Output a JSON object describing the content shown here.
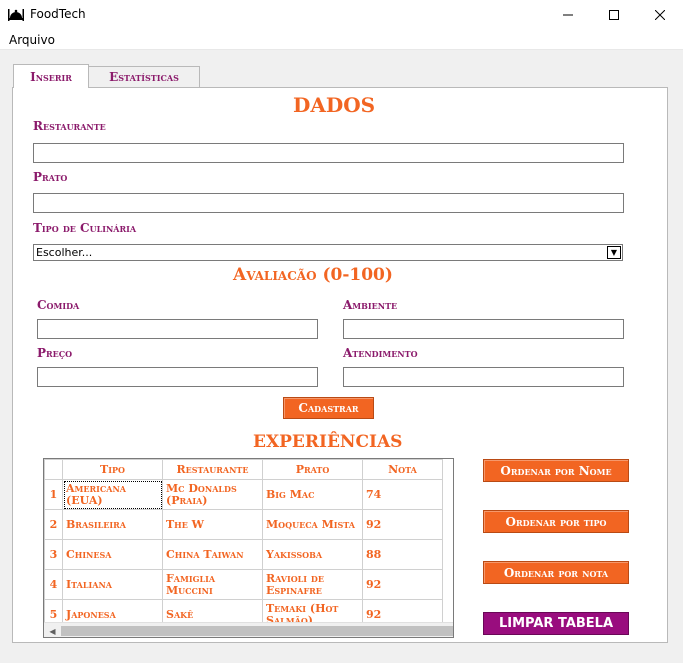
{
  "window": {
    "title": "FoodTech",
    "minimize": "—",
    "maximize": "☐",
    "close": "✕"
  },
  "menu": {
    "file": "Arquivo"
  },
  "tabs": {
    "insert": "Inserir",
    "stats": "Estatísticas"
  },
  "form": {
    "section_title": "DADOS",
    "restaurant_label": "Restaurante",
    "restaurant_value": "",
    "dish_label": "Prato",
    "dish_value": "",
    "cuisine_label": "Tipo de Culinária",
    "cuisine_selected": "Escolher...",
    "rating_title": "Avaliacão (0-100)",
    "food_label": "Comida",
    "food_value": "",
    "ambience_label": "Ambiente",
    "ambience_value": "",
    "price_label": "Preço",
    "price_value": "",
    "service_label": "Atendimento",
    "service_value": "",
    "submit_label": "Cadastrar"
  },
  "experiences": {
    "title": "EXPERIÊNCIAS",
    "columns": [
      "Tipo",
      "Restaurante",
      "Prato",
      "Nota"
    ],
    "rows": [
      {
        "num": "1",
        "tipo": "Americana (EUA)",
        "restaurante": "Mc Donalds (Praia)",
        "prato": "Big Mac",
        "nota": "74"
      },
      {
        "num": "2",
        "tipo": "Brasileira",
        "restaurante": "The W",
        "prato": "Moqueca Mista",
        "nota": "92"
      },
      {
        "num": "3",
        "tipo": "Chinesa",
        "restaurante": "China Taiwan",
        "prato": "Yakissoba",
        "nota": "88"
      },
      {
        "num": "4",
        "tipo": "Italiana",
        "restaurante": "Famiglia Muccini",
        "prato": "Ravioli de Espinafre",
        "nota": "92"
      },
      {
        "num": "5",
        "tipo": "Japonesa",
        "restaurante": "Sakê",
        "prato": "Temaki (Hot Salmão)",
        "nota": "92"
      }
    ]
  },
  "actions": {
    "sort_name": "Ordenar por Nome",
    "sort_type": "Ordenar por tipo",
    "sort_grade": "Ordenar por nota",
    "clear": "LIMPAR TABELA"
  },
  "colors": {
    "accent": "#f26522",
    "brand": "#8b1a6b",
    "danger": "#990d7e"
  },
  "icons": {
    "app": "bell-food-icon",
    "dropdown": "chevron-down-icon"
  }
}
